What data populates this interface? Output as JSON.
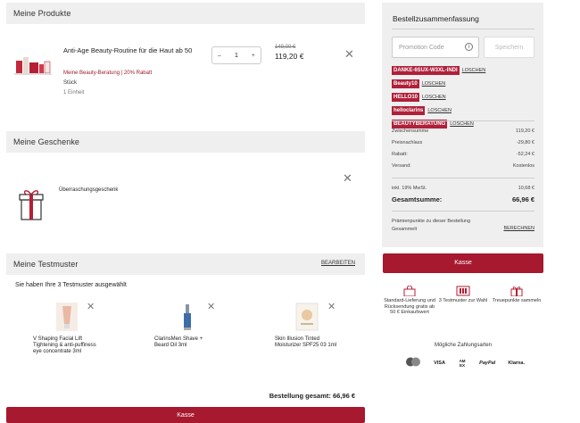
{
  "products_section": {
    "title": "Meine Produkte",
    "product": {
      "name": "Anti-Age Beauty-Routine für die Haut ab 50",
      "promo": "Meine Beauty-Beratung | 20% Rabatt",
      "unit_type": "Stück",
      "quantity_note": "1 Einheit",
      "quantity": "1",
      "old_price": "149,00 €",
      "price": "119,20 €"
    }
  },
  "gifts_section": {
    "title": "Meine Geschenke",
    "gift_name": "Überraschungsgeschenk"
  },
  "samples_section": {
    "title": "Meine Testmuster",
    "edit_label": "BEARBEITEN",
    "selected_text": "Sie haben Ihre 3 Testmuster ausgewählt",
    "samples": [
      {
        "name": "V Shaping Facial Lift Tightening & anti-puffiness eye concentrate 3ml"
      },
      {
        "name": "ClarinsMen Shave + Beard Oil 3ml"
      },
      {
        "name": "Skin Illusion Tinted Moisturizer SPF25 03 1ml"
      }
    ]
  },
  "order_total": {
    "label": "Bestellung gesamt: 66,96 €"
  },
  "checkout_button_label": "Kasse",
  "summary": {
    "title": "Bestellzusammenfassung",
    "promo_placeholder": "Promotion Code",
    "apply_label": "Speichern",
    "remove_label": "LOSCHEN",
    "codes": [
      "DANKE-6SUX-W3XL-INDI",
      "Beauty10",
      "HELLO10",
      "helloclarins",
      "BEAUTYBERATUNG"
    ],
    "rows": [
      {
        "label": "Zwischensumme",
        "value": "119,20 €"
      },
      {
        "label": "Preisnachlass",
        "value": "-29,80 €"
      },
      {
        "label": "Rabatt:",
        "value": "-52,24 €"
      },
      {
        "label": "Versand:",
        "value": "Kostenlos"
      }
    ],
    "vat_label": "inkl. 19% MwSt.",
    "vat_value": "10,68 €",
    "total_label": "Gesamtsumme:",
    "total_value": "66,96 €",
    "points_text": "Prämienpunkte zu dieser Bestellung",
    "points_sub": "Gesammelt",
    "points_link": "BERECHNEN"
  },
  "features": [
    {
      "icon": "bag-icon",
      "text": "Standard-Lieferung und Rücksendung gratis ab 50 € Einkaufswert"
    },
    {
      "icon": "sample-icon",
      "text": "3 Testmuster zur Wahl"
    },
    {
      "icon": "gift-icon",
      "text": "Treuepunkte sammeln"
    }
  ],
  "payment": {
    "title": "Mögliche Zahlungsarten",
    "methods": [
      "VISA",
      "AM EX",
      "PayPal",
      "Klarna."
    ]
  },
  "colors": {
    "accent": "#a6192e",
    "panel_bg": "#efefef"
  }
}
